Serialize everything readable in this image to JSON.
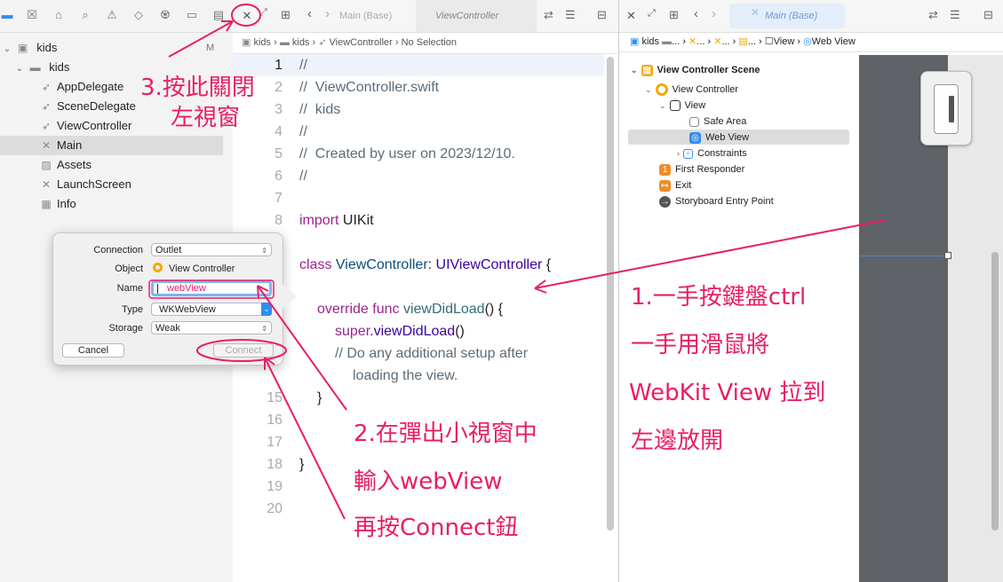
{
  "navigator": {
    "project": "kids",
    "badge": "M",
    "items": [
      {
        "label": "kids",
        "icon": "folder-icon",
        "depth": 1
      },
      {
        "label": "AppDelegate",
        "icon": "swift-file-icon",
        "depth": 2
      },
      {
        "label": "SceneDelegate",
        "icon": "swift-file-icon",
        "depth": 2
      },
      {
        "label": "ViewController",
        "icon": "swift-file-icon",
        "depth": 2
      },
      {
        "label": "Main",
        "icon": "storyboard-icon",
        "depth": 2
      },
      {
        "label": "Assets",
        "icon": "asset-catalog-icon",
        "depth": 2
      },
      {
        "label": "LaunchScreen",
        "icon": "storyboard-icon",
        "depth": 2
      },
      {
        "label": "Info",
        "icon": "plist-icon",
        "depth": 2
      }
    ]
  },
  "editor": {
    "tab_main": "Main (Base)",
    "tab_active": "ViewController",
    "jump": [
      "kids",
      "kids",
      "ViewController",
      "No Selection"
    ],
    "lines": [
      "1",
      "2",
      "3",
      "4",
      "5",
      "6",
      "7",
      "8",
      "15",
      "16",
      "17",
      "18",
      "19",
      "20"
    ]
  },
  "code": {
    "l1": "//",
    "l2": "//  ViewController.swift",
    "l3": "//  kids",
    "l4": "//",
    "l5": "//  Created by user on 2023/12/10.",
    "l6": "//",
    "l8_kw": "import",
    "l8_rest": " UIKit",
    "l10_kw": "class",
    "l10_name": " ViewController",
    "l10_colon": ": ",
    "l10_super": "UIViewController",
    "l10_brace": " {",
    "l12_kw": "override func",
    "l12_name": " viewDidLoad",
    "l12_rest": "() {",
    "l13_kw": "super",
    "l13_name": ".viewDidLoad",
    "l13_rest": "()",
    "l14a": "// Do any additional setup after",
    "l14b": "loading the view.",
    "l15": "}",
    "l18": "}"
  },
  "ib": {
    "tab": "Main (Base)",
    "jump": [
      "kids",
      "...",
      "...",
      "...",
      "...",
      "View",
      "Web View"
    ],
    "outline": [
      {
        "label": "View Controller Scene",
        "depth": 0,
        "icon": "scene-icon",
        "color": "#f2a900"
      },
      {
        "label": "View Controller",
        "depth": 1,
        "icon": "view-controller-icon",
        "color": "#f2a900"
      },
      {
        "label": "View",
        "depth": 2,
        "icon": "view-icon",
        "color": "#555555"
      },
      {
        "label": "Safe Area",
        "depth": 3,
        "icon": "safe-area-icon",
        "color": "#888888"
      },
      {
        "label": "Web View",
        "depth": 3,
        "icon": "web-view-icon",
        "color": "#2f8ef0"
      },
      {
        "label": "Constraints",
        "depth": 3,
        "icon": "constraints-icon",
        "color": "#2f8ef0"
      },
      {
        "label": "First Responder",
        "depth": 1,
        "icon": "first-responder-icon",
        "color": "#f08c28"
      },
      {
        "label": "Exit",
        "depth": 1,
        "icon": "exit-icon",
        "color": "#f08c28"
      },
      {
        "label": "Storyboard Entry Point",
        "depth": 1,
        "icon": "entry-point-icon",
        "color": "#555555"
      }
    ]
  },
  "popup": {
    "connection_label": "Connection",
    "connection_value": "Outlet",
    "object_label": "Object",
    "object_value": "View Controller",
    "name_label": "Name",
    "name_value": "webView",
    "type_label": "Type",
    "type_value": "WKWebView",
    "storage_label": "Storage",
    "storage_value": "Weak",
    "cancel": "Cancel",
    "connect": "Connect"
  },
  "annotations": {
    "step3_line1": "3.按此關閉",
    "step3_line2": "左視窗",
    "step1_line1": "1.一手按鍵盤ctrl",
    "step1_line2": "一手用滑鼠將",
    "step1_line3": "WebKit View 拉到",
    "step1_line4": "左邊放開",
    "step2_line1": "2.在彈出小視窗中",
    "step2_line2": "輸入webView",
    "step2_line3": "再按Connect鈕"
  },
  "colors": {
    "annotation": "#e91e63",
    "accent": "#2f8ef0",
    "keyword": "#9b2393",
    "comment": "#5d6c79"
  }
}
